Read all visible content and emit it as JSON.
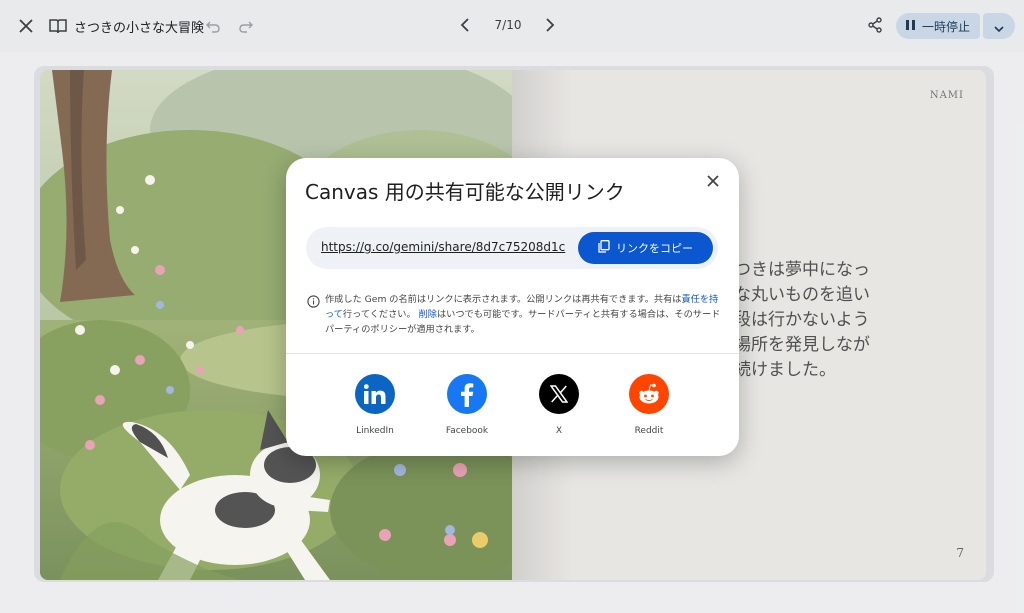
{
  "header": {
    "title": "さつきの小さな大冒険",
    "pager": "7/10",
    "pause_label": "一時停止"
  },
  "book": {
    "author": "NAMI",
    "story_lines": [
      "つきは夢中になっ",
      "な丸いものを追い",
      "段は行かないよう",
      "場所を発見しなが",
      "続けました。"
    ],
    "page_number": "7"
  },
  "dialog": {
    "title": "Canvas 用の共有可能な公開リンク",
    "url": "https://g.co/gemini/share/8d7c75208d1c",
    "copy_label": "リンクをコピー",
    "info_part1": "作成した Gem の名前はリンクに表示されます。公開リンクは再共有できます。共有は",
    "info_link1": "責任を持って",
    "info_part2": "行ってください。",
    "info_link2": "削除",
    "info_part3": "はいつでも可能です。サードパーティと共有する場合は、そのサードパーティのポリシーが適用されます。",
    "share_options": [
      {
        "name": "LinkedIn",
        "color": "#0a66c2"
      },
      {
        "name": "Facebook",
        "color": "#1877f2"
      },
      {
        "name": "X",
        "color": "#000000"
      },
      {
        "name": "Reddit",
        "color": "#ff4500"
      }
    ]
  }
}
